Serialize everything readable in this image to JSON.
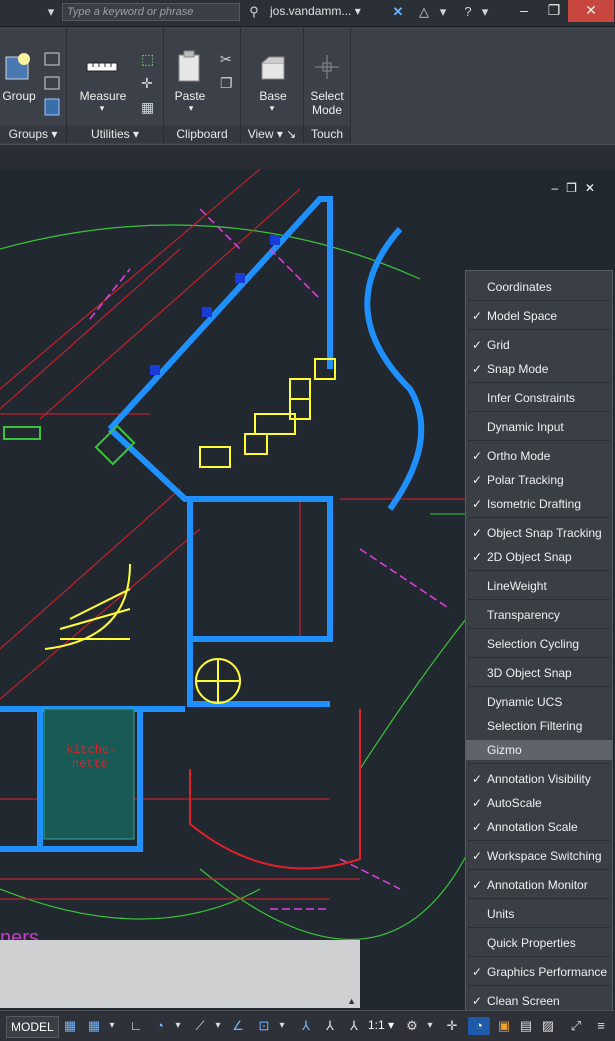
{
  "search": {
    "placeholder": "Type a keyword or phrase"
  },
  "user": {
    "name": "jos.vandamm..."
  },
  "ribbon": {
    "panels": [
      {
        "label": "Groups",
        "big_buttons": [
          "Group"
        ]
      },
      {
        "label": "Utilities",
        "big_buttons": [
          "Measure"
        ]
      },
      {
        "label": "Clipboard",
        "big_buttons": [
          "Paste"
        ]
      },
      {
        "label": "View",
        "big_buttons": [
          "Base"
        ]
      },
      {
        "label": "Touch",
        "big_buttons": [
          "Select",
          "Mode"
        ]
      }
    ]
  },
  "status_menu": {
    "items": [
      {
        "label": "Coordinates",
        "checked": false
      },
      {
        "label": "Model Space",
        "checked": true
      },
      {
        "label": "Grid",
        "checked": true
      },
      {
        "label": "Snap Mode",
        "checked": true
      },
      {
        "label": "Infer Constraints",
        "checked": false
      },
      {
        "label": "Dynamic Input",
        "checked": false
      },
      {
        "label": "Ortho Mode",
        "checked": true
      },
      {
        "label": "Polar Tracking",
        "checked": true
      },
      {
        "label": "Isometric Drafting",
        "checked": true
      },
      {
        "label": "Object Snap Tracking",
        "checked": true
      },
      {
        "label": "2D Object Snap",
        "checked": true
      },
      {
        "label": "LineWeight",
        "checked": false
      },
      {
        "label": "Transparency",
        "checked": false
      },
      {
        "label": "Selection Cycling",
        "checked": false
      },
      {
        "label": "3D Object Snap",
        "checked": false
      },
      {
        "label": "Dynamic UCS",
        "checked": false
      },
      {
        "label": "Selection Filtering",
        "checked": false
      },
      {
        "label": "Gizmo",
        "checked": false,
        "highlighted": true
      },
      {
        "label": "Annotation Visibility",
        "checked": true
      },
      {
        "label": "AutoScale",
        "checked": true
      },
      {
        "label": "Annotation Scale",
        "checked": true
      },
      {
        "label": "Workspace Switching",
        "checked": true
      },
      {
        "label": "Annotation Monitor",
        "checked": true
      },
      {
        "label": "Units",
        "checked": false
      },
      {
        "label": "Quick Properties",
        "checked": false
      },
      {
        "label": "Graphics Performance",
        "checked": true
      },
      {
        "label": "Clean Screen",
        "checked": true
      }
    ],
    "check_glyph": "✓"
  },
  "statusbar": {
    "model_label": "MODEL",
    "scale": "1:1"
  },
  "drawing": {
    "room_label": "kitche-\nnette",
    "partial_text": "ners"
  },
  "colors": {
    "wall": "#1e90ff",
    "dim": "#e0202a",
    "stair": "#ffff33",
    "green": "#3ac43a",
    "magenta": "#e040e0"
  }
}
